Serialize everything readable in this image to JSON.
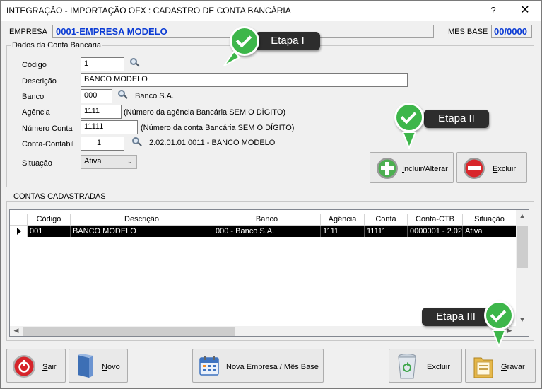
{
  "window": {
    "title": "INTEGRAÇÃO - IMPORTAÇÃO OFX : CADASTRO DE CONTA BANCÁRIA",
    "help_label": "?",
    "close_label": "✕"
  },
  "header": {
    "empresa_label": "EMPRESA",
    "empresa_value": "0001-EMPRESA MODELO",
    "mes_base_label": "MES BASE",
    "mes_base_value": "00/0000"
  },
  "dados": {
    "group_title": "Dados da Conta Bancária",
    "codigo_label": "Código",
    "codigo_value": "1",
    "descricao_label": "Descrição",
    "descricao_value": "BANCO MODELO",
    "banco_label": "Banco",
    "banco_value": "000",
    "banco_name": "Banco S.A.",
    "agencia_label": "Agência",
    "agencia_value": "1111",
    "agencia_hint": "(Número da agência Bancária SEM O DÍGITO)",
    "numero_conta_label": "Número Conta",
    "numero_conta_value": "11111",
    "numero_conta_hint": "(Número da conta Bancária SEM O DÍGITO)",
    "conta_contabil_label": "Conta-Contabil",
    "conta_contabil_value": "1",
    "conta_contabil_desc": "2.02.01.01.0011 - BANCO MODELO",
    "situacao_label": "Situação",
    "situacao_value": "Ativa",
    "incluir_label": "ncluir/Alterar",
    "incluir_mnemonic": "I",
    "excluir_label": "xcluir",
    "excluir_mnemonic": "E"
  },
  "contas": {
    "group_title": "CONTAS CADASTRADAS",
    "columns": [
      "Código",
      "Descrição",
      "Banco",
      "Agência",
      "Conta",
      "Conta-CTB",
      "Situação"
    ],
    "rows": [
      [
        "001",
        "BANCO MODELO",
        "000  - Banco S.A.",
        "1111",
        "11111",
        "0000001 - 2.02",
        "Ativa"
      ]
    ]
  },
  "footer": {
    "sair_mnemonic": "S",
    "sair_label": "air",
    "novo_mnemonic": "N",
    "novo_label": "ovo",
    "nova_empresa_label": "Nova Empresa / Mês Base",
    "excluir_label": "Excluir",
    "gravar_mnemonic": "G",
    "gravar_label": "ravar"
  },
  "callouts": {
    "etapa1": "Etapa I",
    "etapa2": "Etapa II",
    "etapa3": "Etapa III"
  },
  "colors": {
    "accent_blue": "#0c3cd4",
    "callout_green": "#3db64a",
    "callout_dark": "#2d2d2d"
  }
}
